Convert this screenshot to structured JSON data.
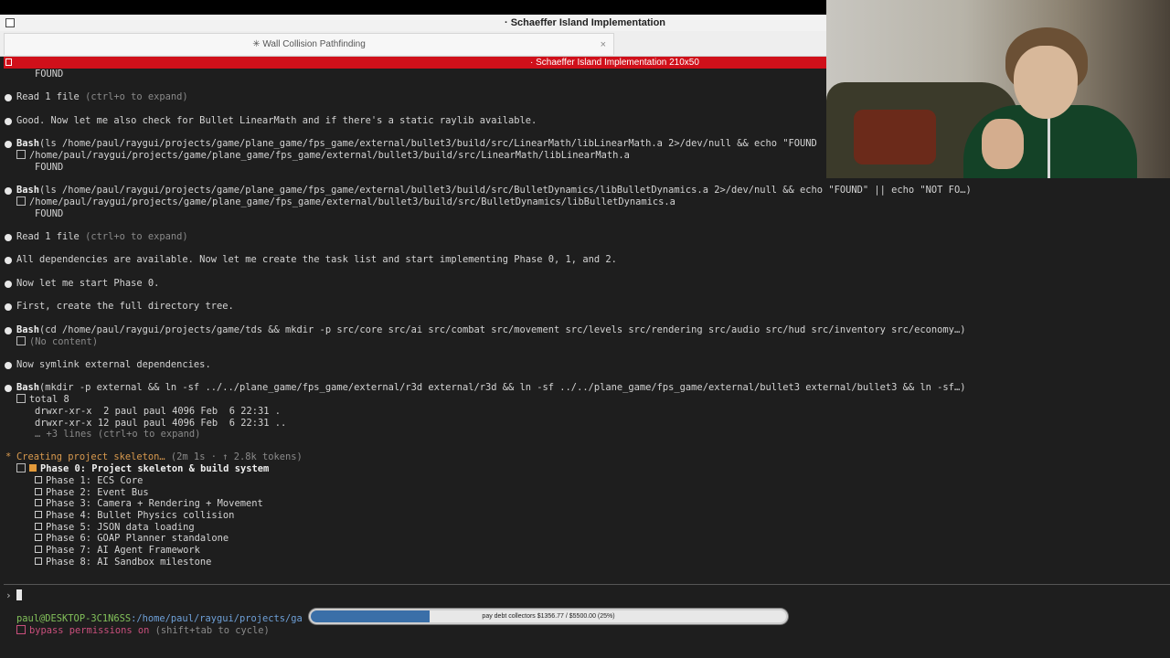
{
  "window": {
    "title": "· Schaeffer Island Implementation"
  },
  "tab": {
    "label": "✳ Wall Collision Pathfinding",
    "close_icon": "×"
  },
  "tmux": {
    "title": "· Schaeffer Island Implementation 210x50"
  },
  "terminal": {
    "lines": {
      "found_top": "FOUND",
      "read1_a": "Read 1 file",
      "read1_a_hint": " (ctrl+o to expand)",
      "good": "Good. Now let me also check for Bullet LinearMath and if there's a static raylib available.",
      "bash1_tool": "Bash",
      "bash1_cmd": "(ls /home/paul/raygui/projects/game/plane_game/fps_game/external/bullet3/build/src/LinearMath/libLinearMath.a 2>/dev/null && echo \"FOUND",
      "bash1_out": "/home/paul/raygui/projects/game/plane_game/fps_game/external/bullet3/build/src/LinearMath/libLinearMath.a",
      "bash1_found": "FOUND",
      "bash2_tool": "Bash",
      "bash2_cmd": "(ls /home/paul/raygui/projects/game/plane_game/fps_game/external/bullet3/build/src/BulletDynamics/libBulletDynamics.a 2>/dev/null && echo \"FOUND\" || echo \"NOT FO…)",
      "bash2_out": "/home/paul/raygui/projects/game/plane_game/fps_game/external/bullet3/build/src/BulletDynamics/libBulletDynamics.a",
      "bash2_found": "FOUND",
      "read1_b": "Read 1 file",
      "read1_b_hint": " (ctrl+o to expand)",
      "all_deps": "All dependencies are available. Now let me create the task list and start implementing Phase 0, 1, and 2.",
      "start_phase": "Now let me start Phase 0.",
      "first": "First, create the full directory tree.",
      "bash3_tool": "Bash",
      "bash3_cmd": "(cd /home/paul/raygui/projects/game/tds && mkdir -p src/core src/ai src/combat src/movement src/levels src/rendering src/audio src/hud src/inventory src/economy…)",
      "bash3_out": "(No content)",
      "symlink": "Now symlink external dependencies.",
      "bash4_tool": "Bash",
      "bash4_cmd": "(mkdir -p external && ln -sf ../../plane_game/fps_game/external/r3d external/r3d && ln -sf ../../plane_game/fps_game/external/bullet3 external/bullet3 && ln -sf…)",
      "bash4_out1": "total 8",
      "bash4_out2": "drwxr-xr-x  2 paul paul 4096 Feb  6 22:31 .",
      "bash4_out3": "drwxr-xr-x 12 paul paul 4096 Feb  6 22:31 ..",
      "bash4_more": "… +3 lines (ctrl+o to expand)",
      "creating": "Creating project skeleton…",
      "creating_meta": " (2m 1s · ↑ 2.8k tokens)"
    },
    "todos": [
      "Phase 0: Project skeleton & build system",
      "Phase 1: ECS Core",
      "Phase 2: Event Bus",
      "Phase 3: Camera + Rendering + Movement",
      "Phase 4: Bullet Physics collision",
      "Phase 5: JSON data loading",
      "Phase 6: GOAP Planner standalone",
      "Phase 7: AI Agent Framework",
      "Phase 8: AI Sandbox milestone"
    ],
    "prompt_symbol": "›",
    "status_user": "paul@DESKTOP-3C1N6SS",
    "status_path": ":/home/paul/raygui/projects/ga",
    "bypass": "bypass permissions on",
    "bypass_hint": " (shift+tab to cycle)"
  },
  "progress": {
    "label": "pay debt collectors $1356.77 / $5500.00 (25%)",
    "percent": 25
  },
  "colors": {
    "accent_red": "#d0101a",
    "progress_fill": "#3a6fa8",
    "task_orange": "#d99a4e"
  }
}
